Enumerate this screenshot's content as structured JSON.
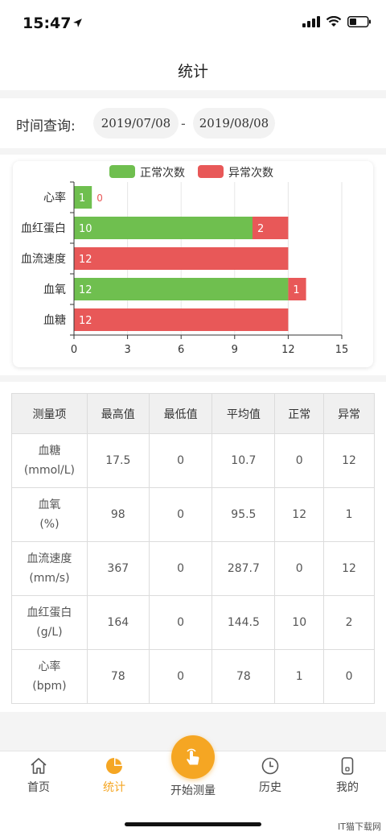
{
  "status_bar": {
    "time": "15:47"
  },
  "nav": {
    "title": "统计"
  },
  "query": {
    "label": "时间查询:",
    "start_date": "2019/07/08",
    "separator": "-",
    "end_date": "2019/08/08"
  },
  "chart_data": {
    "type": "bar",
    "orientation": "horizontal",
    "stacked": true,
    "categories": [
      "心率",
      "血红蛋白",
      "血流速度",
      "血氧",
      "血糖"
    ],
    "series": [
      {
        "name": "正常次数",
        "values": [
          1,
          10,
          0,
          12,
          0
        ],
        "color": "#6fbf4f"
      },
      {
        "name": "异常次数",
        "values": [
          0,
          2,
          12,
          1,
          12
        ],
        "color": "#e85858"
      }
    ],
    "xlim": [
      0,
      15
    ],
    "xticks": [
      0,
      3,
      6,
      9,
      12,
      15
    ],
    "legend": "top",
    "grid": true
  },
  "table": {
    "headers": [
      "测量项",
      "最高值",
      "最低值",
      "平均值",
      "正常",
      "异常"
    ],
    "rows": [
      {
        "name": "血糖",
        "unit": "(mmol/L)",
        "max": "17.5",
        "min": "0",
        "avg": "10.7",
        "normal": "0",
        "abnormal": "12"
      },
      {
        "name": "血氧",
        "unit": "(%)",
        "max": "98",
        "min": "0",
        "avg": "95.5",
        "normal": "12",
        "abnormal": "1"
      },
      {
        "name": "血流速度",
        "unit": "(mm/s)",
        "max": "367",
        "min": "0",
        "avg": "287.7",
        "normal": "0",
        "abnormal": "12"
      },
      {
        "name": "血红蛋白",
        "unit": "(g/L)",
        "max": "164",
        "min": "0",
        "avg": "144.5",
        "normal": "10",
        "abnormal": "2"
      },
      {
        "name": "心率",
        "unit": "(bpm)",
        "max": "78",
        "min": "0",
        "avg": "78",
        "normal": "1",
        "abnormal": "0"
      }
    ]
  },
  "tabs": [
    {
      "label": "首页",
      "icon": "home-icon"
    },
    {
      "label": "统计",
      "icon": "pie-chart-icon",
      "active": true
    },
    {
      "label": "开始测量",
      "icon": "tap-hand-icon"
    },
    {
      "label": "历史",
      "icon": "clock-icon"
    },
    {
      "label": "我的",
      "icon": "phone-icon"
    }
  ],
  "colors": {
    "accent": "#f5a623",
    "normal": "#6fbf4f",
    "abnormal": "#e85858"
  },
  "watermark": "IT猫下载网"
}
